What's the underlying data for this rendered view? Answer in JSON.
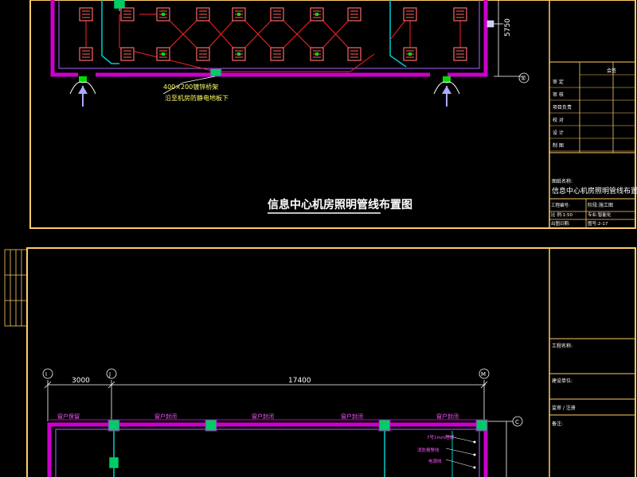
{
  "drawing_top": {
    "title": "信息中心机房照明管线布置图",
    "note_line1": "400×200镀锌桥架",
    "note_line2": "沿至机房防静电地板下",
    "dim_vertical": "5750",
    "axis_bubble": "⑤",
    "title_block": {
      "header": "会签",
      "rows": [
        "审 定",
        "审 核",
        "项目负责",
        "校 对",
        "设 计",
        "制 图"
      ],
      "drawing_name_label": "图纸名称:",
      "drawing_name": "信息中心机房照明管线布置图",
      "project_label": "工程编号:",
      "phase": "阶段:施工图",
      "scale": "比 例:1:50",
      "discipline": "专业:智能化",
      "date_label": "出图日期:",
      "sheet": "图号:2-17"
    }
  },
  "drawing_bottom": {
    "dims": [
      "3000",
      "17400"
    ],
    "axis_labels": [
      "I",
      "J",
      "M",
      "C"
    ],
    "window_labels": [
      "窗户保留",
      "窗户封闭",
      "窗户封闭",
      "窗户封闭",
      "窗户封闭"
    ],
    "legend_items": [
      "7号1mm阻燃",
      "消防报警线",
      "电源线"
    ],
    "title_block": {
      "project_label": "工程名称:",
      "owner_label": "建设单位:",
      "sign_label": "监审 / 注册",
      "remark_label": "备注:"
    }
  },
  "colors": {
    "background": "#000000",
    "frame": "#ffcc66",
    "wall": "#cc00cc",
    "fixture": "#ff5555",
    "wire": "#ff2222",
    "partition": "#00cccc",
    "dimension": "#ffffff",
    "door_marker": "#00dd00"
  }
}
